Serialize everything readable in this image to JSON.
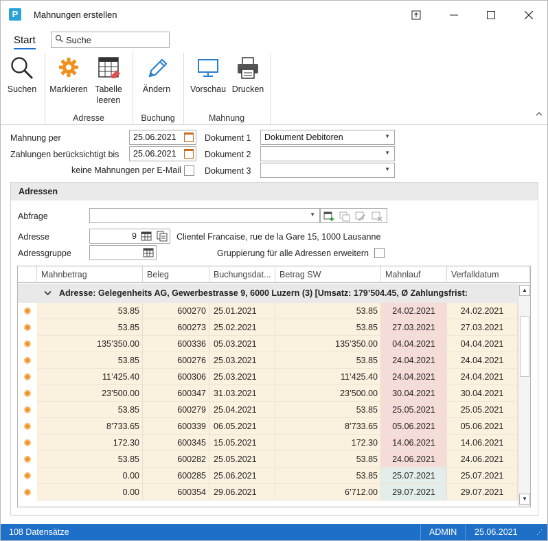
{
  "window": {
    "title": "Mahnungen erstellen",
    "app_icon": "P"
  },
  "ribbon": {
    "tab": "Start",
    "search_placeholder": "Suche",
    "buttons": {
      "suchen": "Suchen",
      "markieren": "Markieren",
      "tabelle_leeren_1": "Tabelle",
      "tabelle_leeren_2": "leeren",
      "aendern": "Ändern",
      "vorschau": "Vorschau",
      "drucken": "Drucken"
    },
    "groups": {
      "adresse": "Adresse",
      "buchung": "Buchung",
      "mahnung": "Mahnung"
    }
  },
  "form": {
    "mahnung_per_label": "Mahnung per",
    "mahnung_per_value": "25.06.2021",
    "zahlungen_label": "Zahlungen berücksichtigt bis",
    "zahlungen_value": "25.06.2021",
    "keine_mahnungen_label": "keine Mahnungen per E-Mail",
    "dokument1_label": "Dokument 1",
    "dokument1_value": "Dokument Debitoren",
    "dokument2_label": "Dokument 2",
    "dokument2_value": "",
    "dokument3_label": "Dokument 3",
    "dokument3_value": ""
  },
  "adressen": {
    "title": "Adressen",
    "abfrage_label": "Abfrage",
    "abfrage_value": "",
    "adresse_label": "Adresse",
    "adresse_value": "9",
    "adresse_text": "Clientel Francaise, rue de la Gare 15, 1000 Lausanne",
    "adressgruppe_label": "Adressgruppe",
    "gruppierung_label": "Gruppierung für alle Adressen erweitern"
  },
  "grid": {
    "columns": [
      "Mahnbetrag",
      "Beleg",
      "Buchungsdat...",
      "Betrag SW",
      "Mahnlauf",
      "Verfalldatum"
    ],
    "group_label": "Adresse: Gelegenheits AG, Gewerbestrasse 9, 6000 Luzern (3) [Umsatz: 179’504.45, Ø Zahlungsfrist:",
    "rows": [
      {
        "mahnbetrag": "53.85",
        "beleg": "600270",
        "buchungsdatum": "25.01.2021",
        "betrag_sw": "53.85",
        "mahnlauf": "24.02.2021",
        "verfall": "24.02.2021",
        "status": "overdue"
      },
      {
        "mahnbetrag": "53.85",
        "beleg": "600273",
        "buchungsdatum": "25.02.2021",
        "betrag_sw": "53.85",
        "mahnlauf": "27.03.2021",
        "verfall": "27.03.2021",
        "status": "overdue"
      },
      {
        "mahnbetrag": "135’350.00",
        "beleg": "600336",
        "buchungsdatum": "05.03.2021",
        "betrag_sw": "135’350.00",
        "mahnlauf": "04.04.2021",
        "verfall": "04.04.2021",
        "status": "overdue"
      },
      {
        "mahnbetrag": "53.85",
        "beleg": "600276",
        "buchungsdatum": "25.03.2021",
        "betrag_sw": "53.85",
        "mahnlauf": "24.04.2021",
        "verfall": "24.04.2021",
        "status": "overdue"
      },
      {
        "mahnbetrag": "11’425.40",
        "beleg": "600306",
        "buchungsdatum": "25.03.2021",
        "betrag_sw": "11’425.40",
        "mahnlauf": "24.04.2021",
        "verfall": "24.04.2021",
        "status": "overdue"
      },
      {
        "mahnbetrag": "23’500.00",
        "beleg": "600347",
        "buchungsdatum": "31.03.2021",
        "betrag_sw": "23’500.00",
        "mahnlauf": "30.04.2021",
        "verfall": "30.04.2021",
        "status": "overdue"
      },
      {
        "mahnbetrag": "53.85",
        "beleg": "600279",
        "buchungsdatum": "25.04.2021",
        "betrag_sw": "53.85",
        "mahnlauf": "25.05.2021",
        "verfall": "25.05.2021",
        "status": "overdue"
      },
      {
        "mahnbetrag": "8’733.65",
        "beleg": "600339",
        "buchungsdatum": "06.05.2021",
        "betrag_sw": "8’733.65",
        "mahnlauf": "05.06.2021",
        "verfall": "05.06.2021",
        "status": "overdue"
      },
      {
        "mahnbetrag": "172.30",
        "beleg": "600345",
        "buchungsdatum": "15.05.2021",
        "betrag_sw": "172.30",
        "mahnlauf": "14.06.2021",
        "verfall": "14.06.2021",
        "status": "overdue"
      },
      {
        "mahnbetrag": "53.85",
        "beleg": "600282",
        "buchungsdatum": "25.05.2021",
        "betrag_sw": "53.85",
        "mahnlauf": "24.06.2021",
        "verfall": "24.06.2021",
        "status": "overdue"
      },
      {
        "mahnbetrag": "0.00",
        "beleg": "600285",
        "buchungsdatum": "25.06.2021",
        "betrag_sw": "53.85",
        "mahnlauf": "25.07.2021",
        "verfall": "25.07.2021",
        "status": "open"
      },
      {
        "mahnbetrag": "0.00",
        "beleg": "600354",
        "buchungsdatum": "29.06.2021",
        "betrag_sw": "6’712.00",
        "mahnlauf": "29.07.2021",
        "verfall": "29.07.2021",
        "status": "open"
      }
    ]
  },
  "status": {
    "count": "108 Datensätze",
    "user": "ADMIN",
    "date": "25.06.2021"
  },
  "colors": {
    "accent": "#1e6fc7",
    "row_bg": "#fbf1df",
    "overdue_bg": "#f6dcd8",
    "open_bg": "#e3eeeb",
    "gear": "#f0901e"
  }
}
